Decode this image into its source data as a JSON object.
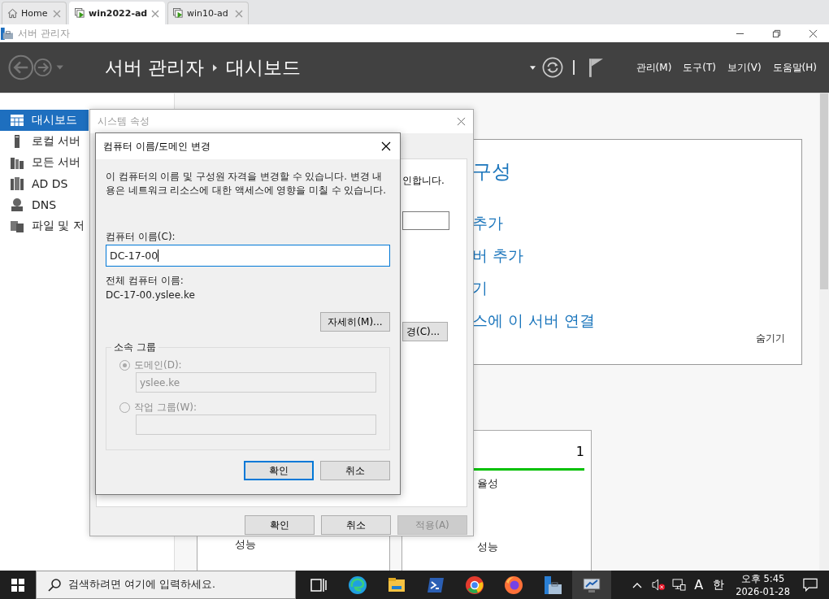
{
  "browser_tabs": [
    {
      "label": "Home",
      "kind": "home",
      "selected": false
    },
    {
      "label": "win2022-ad",
      "kind": "vm",
      "selected": true
    },
    {
      "label": "win10-ad",
      "kind": "vm",
      "selected": false
    }
  ],
  "app_title": "서버 관리자",
  "header": {
    "breadcrumb": [
      "서버 관리자",
      "대시보드"
    ],
    "menus": [
      "관리(M)",
      "도구(T)",
      "보기(V)",
      "도움말(H)"
    ]
  },
  "sidebar": {
    "items": [
      {
        "label": "대시보드",
        "kind": "dashboard",
        "selected": true
      },
      {
        "label": "로컬 서버",
        "kind": "local",
        "selected": false
      },
      {
        "label": "모든 서버",
        "kind": "all",
        "selected": false
      },
      {
        "label": "AD DS",
        "kind": "adds",
        "selected": false
      },
      {
        "label": "DNS",
        "kind": "dns",
        "selected": false
      },
      {
        "label": "파일 및 저",
        "kind": "files",
        "selected": false
      }
    ]
  },
  "welcome": {
    "heading": "구성",
    "links": [
      "추가",
      "버 추가",
      "기",
      "스에 이 서버 연결"
    ],
    "hide": "숨기기"
  },
  "tiles": [
    {
      "items": [
        "성능"
      ]
    },
    {
      "count": "1",
      "color": "#00c000",
      "items": [
        "율성",
        "성능"
      ]
    }
  ],
  "system_dialog": {
    "title": "시스템 속성",
    "text": "인합니다.",
    "change_button": "경(C)...",
    "buttons": [
      {
        "label": "확인",
        "disabled": false
      },
      {
        "label": "취소",
        "disabled": false
      },
      {
        "label": "적용(A)",
        "disabled": true
      }
    ]
  },
  "name_dialog": {
    "title": "컴퓨터 이름/도메인 변경",
    "description": "이 컴퓨터의 이름 및 구성원 자격을 변경할 수 있습니다. 변경 내용은 네트워크 리소스에 대한 액세스에 영향을 미칠 수 있습니다.",
    "name_label": "컴퓨터 이름(C):",
    "name_value": "DC-17-00",
    "full_name_label": "전체 컴퓨터 이름:",
    "full_name": "DC-17-00.yslee.ke",
    "more_button": "자세히(M)...",
    "group_title": "소속 그룹",
    "options": [
      {
        "label": "도메인(D):",
        "value": "yslee.ke",
        "selected": true,
        "disabled": true
      },
      {
        "label": "작업 그룹(W):",
        "selected": false,
        "disabled": true
      }
    ],
    "buttons": [
      {
        "label": "확인",
        "default": true
      },
      {
        "label": "취소",
        "default": false
      }
    ]
  },
  "taskbar": {
    "search_placeholder": "검색하려면 여기에 입력하세요.",
    "apps": [
      {
        "kind": "taskview",
        "active": false
      },
      {
        "kind": "edge",
        "active": false
      },
      {
        "kind": "explorer",
        "active": false
      },
      {
        "kind": "powershell",
        "active": false
      },
      {
        "kind": "chrome",
        "active": false
      },
      {
        "kind": "firefox",
        "active": false
      },
      {
        "kind": "servermanager",
        "active": false
      },
      {
        "kind": "remote",
        "active": true
      }
    ],
    "ime": "A",
    "lang": "한",
    "time": "오후 5:45",
    "date": "2026-01-28"
  }
}
